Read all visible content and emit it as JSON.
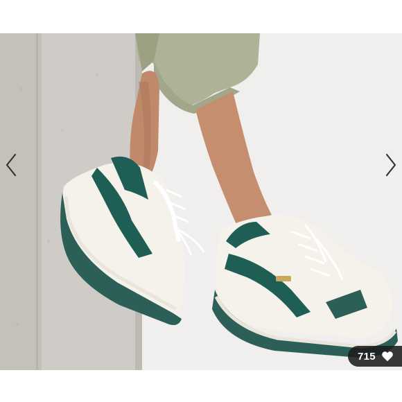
{
  "gallery": {
    "photo_alt": "",
    "prev_icon": "chevron-left-icon",
    "next_icon": "chevron-right-icon"
  },
  "likes": {
    "count": "715",
    "icon": "heart-icon"
  },
  "colors": {
    "sneaker_accent": "#1f5e55",
    "sneaker_body": "#f4f2ea",
    "pants": "#aeb397",
    "badge_bg": "#1c1c1c"
  }
}
